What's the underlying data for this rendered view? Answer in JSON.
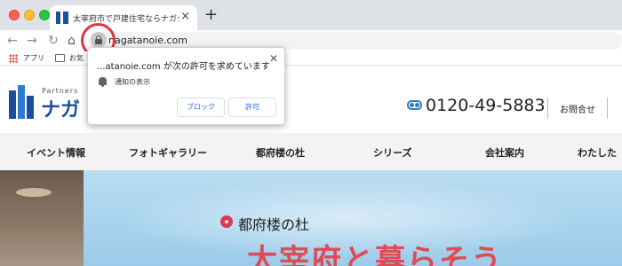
{
  "browser": {
    "tab": {
      "title": "太宰府市で戸建住宅ならナガタ建設"
    },
    "url": "nagatanoie.com",
    "bookmarks": {
      "apps_label": "アプリ",
      "folder_label": "お気"
    }
  },
  "site": {
    "logo": {
      "small_text": "Partners",
      "big_text": "ナガ"
    },
    "phone": "0120-49-5883",
    "contact_label": "お問合せ",
    "nav": [
      "イベント情報",
      "フォトギャラリー",
      "都府楼の杜",
      "シリーズ",
      "会社案内",
      "わたした"
    ],
    "hero": {
      "label": "都府楼の杜",
      "calligraphy": "太宰府と暮らそう"
    }
  },
  "permission_popup": {
    "title": "...atanoie.com が次の許可を求めています",
    "item_label": "通知の表示",
    "block_label": "ブロック",
    "allow_label": "許可"
  }
}
